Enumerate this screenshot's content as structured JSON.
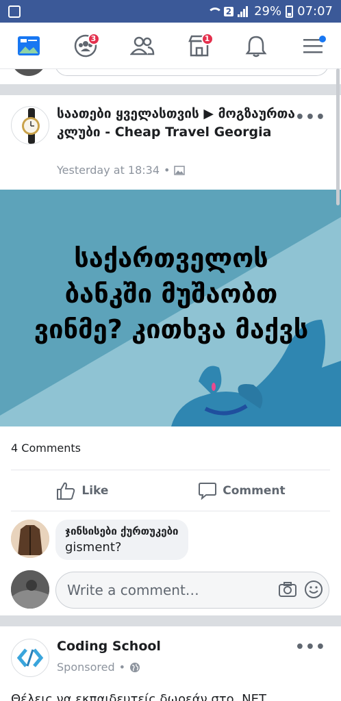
{
  "status_bar": {
    "sim_badge": "2",
    "battery": "29%",
    "time": "07:07"
  },
  "nav": {
    "items": [
      {
        "name": "news-feed",
        "badge": ""
      },
      {
        "name": "groups",
        "badge": "3"
      },
      {
        "name": "friends",
        "badge": ""
      },
      {
        "name": "marketplace",
        "badge": "1"
      },
      {
        "name": "notifications",
        "badge": ""
      },
      {
        "name": "menu",
        "badge": ""
      }
    ]
  },
  "post": {
    "title": "საათები ყველასთვის ▶ მოგზაურთა კლუბი - Cheap Travel Georgia",
    "time": "Yesterday at 18:34",
    "image_text": "საქართველოს ბანკში მუშაობთ ვინმე? კითხვა მაქვს",
    "comments_count": "4 Comments",
    "like_label": "Like",
    "comment_label": "Comment"
  },
  "comment": {
    "author": "ჯინსისები ქურთუკები",
    "text": "gisment?"
  },
  "write_comment": {
    "placeholder": "Write a comment…"
  },
  "post2": {
    "title": "Coding School",
    "meta": "Sponsored",
    "snippet": "Θέλεις να εκπαιδευτείς δωρεάν στο .NET"
  },
  "colors": {
    "header": "#3b5998",
    "image_bg": "#5da3ba",
    "badge": "#e4304d"
  }
}
